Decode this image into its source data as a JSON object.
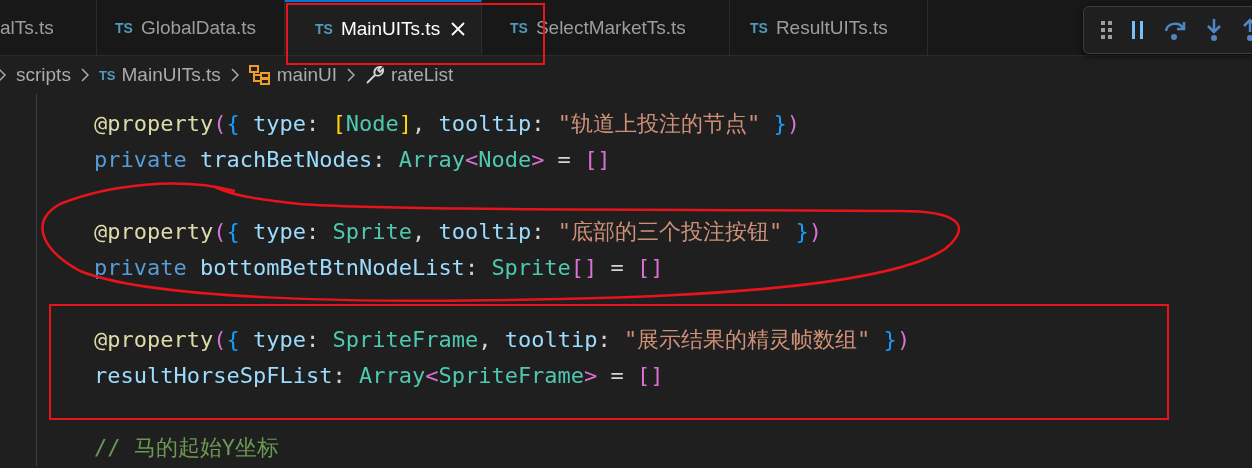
{
  "tabs": [
    {
      "label": "alTs.ts",
      "selected": false
    },
    {
      "label": "GlobalData.ts",
      "selected": false,
      "icon": "TS"
    },
    {
      "label": "MainUITs.ts",
      "selected": true,
      "icon": "TS"
    },
    {
      "label": "SelectMarketTs.ts",
      "selected": false,
      "icon": "TS"
    },
    {
      "label": "ResultUITs.ts",
      "selected": false,
      "icon": "TS"
    }
  ],
  "breadcrumb": [
    {
      "label": "scripts",
      "kind": "folder"
    },
    {
      "label": "MainUITs.ts",
      "kind": "file",
      "icon": "TS"
    },
    {
      "label": "mainUI",
      "kind": "class"
    },
    {
      "label": "rateList",
      "kind": "property"
    }
  ],
  "code_blocks": [
    [
      [
        {
          "text": "@property",
          "kind": "decorator"
        },
        {
          "text": "(",
          "kind": "bracket1"
        },
        {
          "text": "{",
          "kind": "bracket2"
        },
        {
          "text": " type",
          "kind": "prop"
        },
        {
          "text": ": ",
          "kind": "punct"
        },
        {
          "text": "[",
          "kind": "bracket3"
        },
        {
          "text": "Node",
          "kind": "type"
        },
        {
          "text": "]",
          "kind": "bracket3"
        },
        {
          "text": ", ",
          "kind": "punct"
        },
        {
          "text": "tooltip",
          "kind": "prop"
        },
        {
          "text": ": ",
          "kind": "punct"
        },
        {
          "text": "\"轨道上投注的节点\"",
          "kind": "string"
        },
        {
          "text": " }",
          "kind": "bracket2"
        },
        {
          "text": ")",
          "kind": "bracket1"
        }
      ],
      [
        {
          "text": "private",
          "kind": "keyword"
        },
        {
          "text": " trachBetNodes",
          "kind": "prop"
        },
        {
          "text": ": ",
          "kind": "punct"
        },
        {
          "text": "Array",
          "kind": "type"
        },
        {
          "text": "<",
          "kind": "bracket1"
        },
        {
          "text": "Node",
          "kind": "type"
        },
        {
          "text": ">",
          "kind": "bracket1"
        },
        {
          "text": " = ",
          "kind": "punct"
        },
        {
          "text": "[]",
          "kind": "bracket1"
        }
      ]
    ],
    [
      [
        {
          "text": "@property",
          "kind": "decorator"
        },
        {
          "text": "(",
          "kind": "bracket1"
        },
        {
          "text": "{",
          "kind": "bracket2"
        },
        {
          "text": " type",
          "kind": "prop"
        },
        {
          "text": ": ",
          "kind": "punct"
        },
        {
          "text": "Sprite",
          "kind": "type"
        },
        {
          "text": ", ",
          "kind": "punct"
        },
        {
          "text": "tooltip",
          "kind": "prop"
        },
        {
          "text": ": ",
          "kind": "punct"
        },
        {
          "text": "\"底部的三个投注按钮\"",
          "kind": "string"
        },
        {
          "text": " }",
          "kind": "bracket2"
        },
        {
          "text": ")",
          "kind": "bracket1"
        }
      ],
      [
        {
          "text": "private",
          "kind": "keyword"
        },
        {
          "text": " bottomBetBtnNodeList",
          "kind": "prop"
        },
        {
          "text": ": ",
          "kind": "punct"
        },
        {
          "text": "Sprite",
          "kind": "type"
        },
        {
          "text": "[]",
          "kind": "bracket1"
        },
        {
          "text": " = ",
          "kind": "punct"
        },
        {
          "text": "[]",
          "kind": "bracket1"
        }
      ]
    ],
    [
      [
        {
          "text": "@property",
          "kind": "decorator"
        },
        {
          "text": "(",
          "kind": "bracket1"
        },
        {
          "text": "{",
          "kind": "bracket2"
        },
        {
          "text": " type",
          "kind": "prop"
        },
        {
          "text": ": ",
          "kind": "punct"
        },
        {
          "text": "SpriteFrame",
          "kind": "type"
        },
        {
          "text": ", ",
          "kind": "punct"
        },
        {
          "text": "tooltip",
          "kind": "prop"
        },
        {
          "text": ": ",
          "kind": "punct"
        },
        {
          "text": "\"展示结果的精灵帧数组\"",
          "kind": "string"
        },
        {
          "text": " }",
          "kind": "bracket2"
        },
        {
          "text": ")",
          "kind": "bracket1"
        }
      ],
      [
        {
          "text": "resultHorseSpFList",
          "kind": "prop"
        },
        {
          "text": ": ",
          "kind": "punct"
        },
        {
          "text": "Array",
          "kind": "type"
        },
        {
          "text": "<",
          "kind": "bracket1"
        },
        {
          "text": "SpriteFrame",
          "kind": "type"
        },
        {
          "text": ">",
          "kind": "bracket1"
        },
        {
          "text": " = ",
          "kind": "punct"
        },
        {
          "text": "[]",
          "kind": "bracket1"
        }
      ]
    ],
    [
      [
        {
          "text": "// 马的起始Y坐标",
          "kind": "comment"
        }
      ]
    ]
  ]
}
